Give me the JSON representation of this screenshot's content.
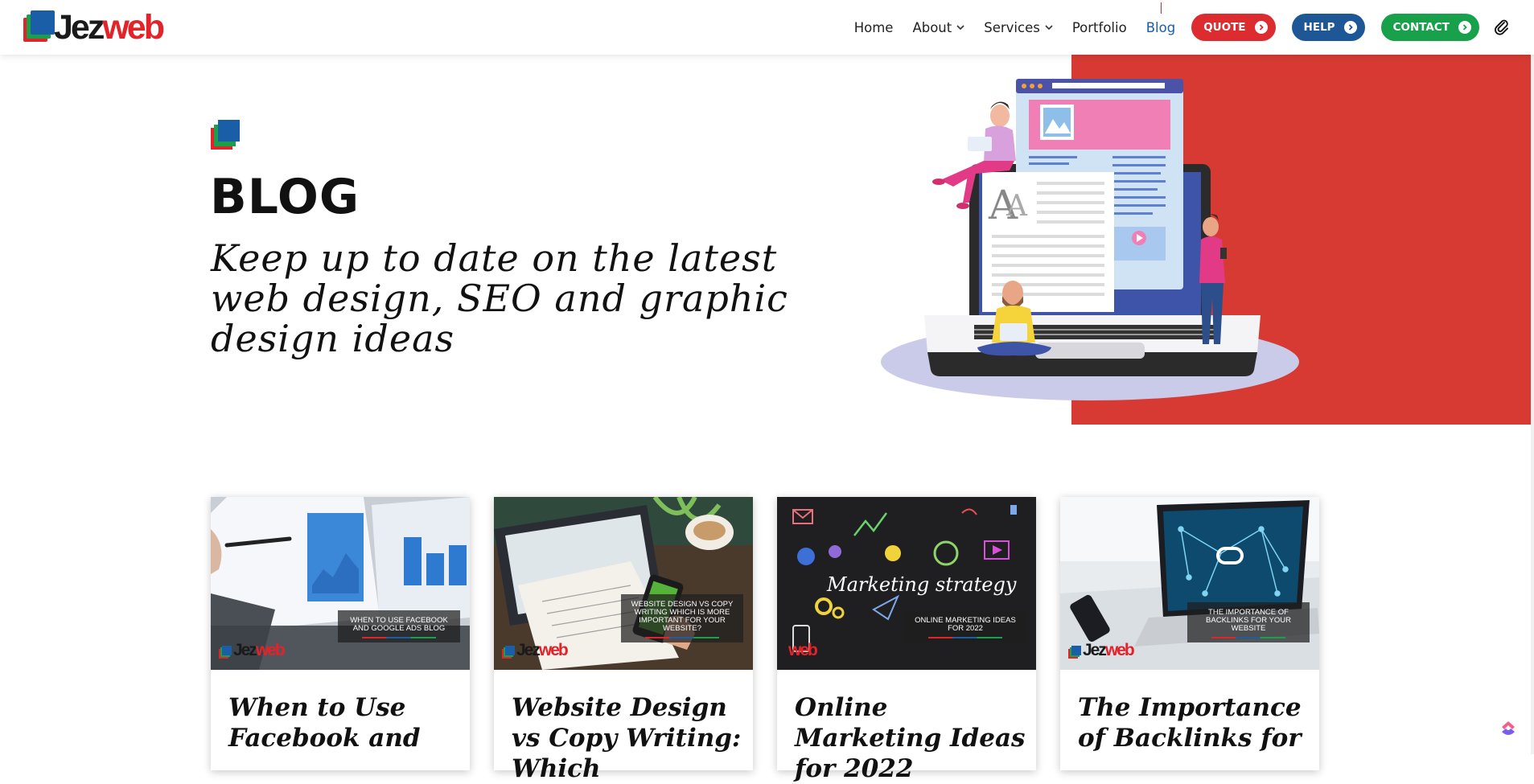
{
  "brand": {
    "logo_text_a": "Jez",
    "logo_text_b": "web",
    "red": "#e2232a",
    "blue": "#1b5ea8",
    "green": "#1aa04b"
  },
  "nav": {
    "items": [
      {
        "label": "Home",
        "has_dropdown": false,
        "active": false
      },
      {
        "label": "About",
        "has_dropdown": true,
        "active": false
      },
      {
        "label": "Services",
        "has_dropdown": true,
        "active": false
      },
      {
        "label": "Portfolio",
        "has_dropdown": false,
        "active": false
      },
      {
        "label": "Blog",
        "has_dropdown": false,
        "active": true
      }
    ],
    "buttons": [
      {
        "label": "QUOTE",
        "color": "#dd2c2f"
      },
      {
        "label": "HELP",
        "color": "#1e5796"
      },
      {
        "label": "CONTACT",
        "color": "#18a04a"
      }
    ],
    "extra_icon": "paperclip-icon"
  },
  "hero": {
    "title": "BLOG",
    "tagline": "Keep up to date on the latest web design, SEO and graphic design ideas",
    "panel_color": "#d63a33"
  },
  "posts": [
    {
      "title": "When to Use Facebook and",
      "thumb_caption": "When to use Facebook and Google Ads Blog"
    },
    {
      "title": "Website Design vs Copy Writing: Which",
      "thumb_caption": "Website Design vs Copy Writing Which is More Important for your Website?"
    },
    {
      "title": "Online Marketing Ideas for 2022",
      "thumb_caption": "Online Marketing Ideas for 2022",
      "thumb_text": "Marketing strategy"
    },
    {
      "title": "The Importance of Backlinks for",
      "thumb_caption": "The Importance of Backlinks for your Website"
    }
  ],
  "widget_icon": "clickup-icon"
}
